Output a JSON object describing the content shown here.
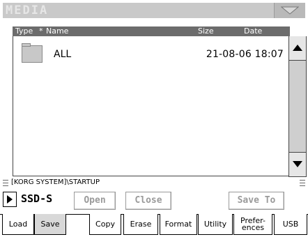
{
  "window": {
    "title": "MEDIA"
  },
  "columns": {
    "type_label": "Type",
    "sort_marker": "*",
    "name_label": "Name",
    "size_label": "Size",
    "date_label": "Date"
  },
  "files": [
    {
      "icon": "folder-icon",
      "name": "ALL",
      "size": "",
      "date": "21-08-06 18:07"
    }
  ],
  "path": "[KORG SYSTEM]\\STARTUP",
  "device": {
    "label": "SSD-S"
  },
  "buttons": {
    "open": "Open",
    "close": "Close",
    "save_to": "Save To"
  },
  "tabs": [
    {
      "label": "Load",
      "active": false
    },
    {
      "label": "Save",
      "active": true
    },
    {
      "label": "Copy",
      "active": false
    },
    {
      "label": "Erase",
      "active": false
    },
    {
      "label": "Format",
      "active": false
    },
    {
      "label": "Utility",
      "active": false
    },
    {
      "label": "Prefer-ences",
      "active": false
    },
    {
      "label": "USB",
      "active": false
    }
  ],
  "colors": {
    "titlebar": "#c9c9c9",
    "header": "#6c6c6c",
    "folder": "#c8c8c8",
    "disabled_text": "#9a9a9a"
  }
}
